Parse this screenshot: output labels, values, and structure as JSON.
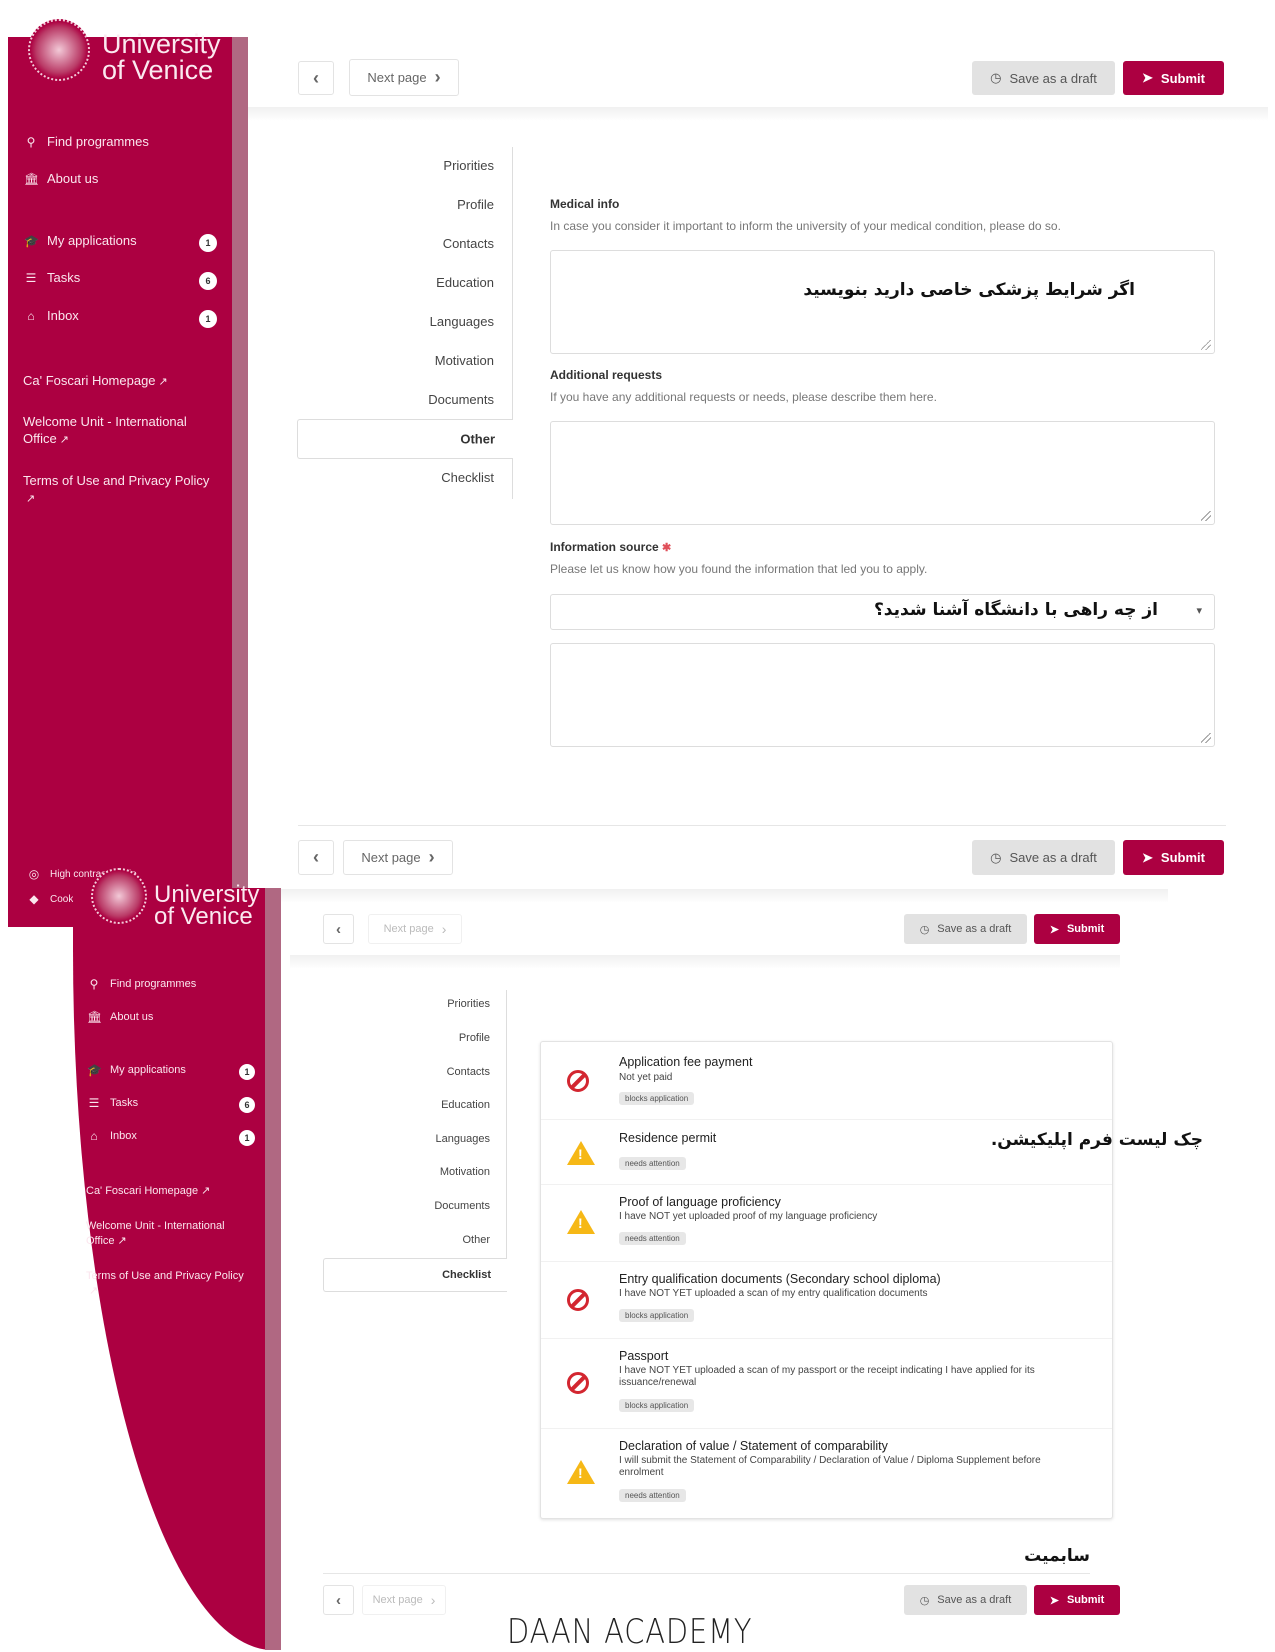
{
  "brand": {
    "line1": "University",
    "line2": "of Venice",
    "seal_text": "IN DOMO FOSCARI"
  },
  "sidebar": {
    "primary": [
      {
        "label": "Find programmes",
        "icon": "search-icon",
        "glyph": "⚲"
      },
      {
        "label": "About us",
        "icon": "institution-icon",
        "glyph": "🏛"
      }
    ],
    "personal": [
      {
        "label": "My applications",
        "icon": "graduation-cap-icon",
        "glyph": "🎓",
        "badge": "1"
      },
      {
        "label": "Tasks",
        "icon": "tasks-icon",
        "glyph": "☰",
        "badge": "6"
      },
      {
        "label": "Inbox",
        "icon": "inbox-icon",
        "glyph": "⌂",
        "badge": "1"
      }
    ],
    "links": [
      {
        "label": "Ca' Foscari Homepage",
        "icon": "external-link-icon"
      },
      {
        "label": "Welcome Unit - International Office",
        "icon": "external-link-icon"
      },
      {
        "label": "Terms of Use and Privacy Policy",
        "icon": "external-link-icon"
      }
    ],
    "footer": [
      {
        "label": "High contrast mode",
        "icon": "contrast-icon"
      },
      {
        "label": "Cook",
        "icon": "tag-icon"
      }
    ]
  },
  "toolbar": {
    "prev_glyph": "‹",
    "next_label": "Next page",
    "next_glyph": "›",
    "draft_label": "Save as a draft",
    "draft_glyph": "◷",
    "submit_label": "Submit",
    "submit_glyph": "➤"
  },
  "tabs": [
    "Priorities",
    "Profile",
    "Contacts",
    "Education",
    "Languages",
    "Motivation",
    "Documents",
    "Other",
    "Checklist"
  ],
  "form": {
    "active_tab": "Other",
    "medical": {
      "label": "Medical info",
      "help": "In case you consider it important to inform the university of your medical condition, please do so.",
      "value": "",
      "annotation": "اگر شرایط پزشکی خاصی دارید بنویسید"
    },
    "additional": {
      "label": "Additional requests",
      "help": "If you have any additional requests or needs, please describe them here.",
      "value": ""
    },
    "info_source": {
      "label": "Information source",
      "required": "✱",
      "help": "Please let us know how you found the information that led you to apply.",
      "select_value": "",
      "select_caret": "▾",
      "annotation": "از چه راهی با دانشگاه آشنا شدید؟",
      "details_value": ""
    }
  },
  "checklist": {
    "active_tab": "Checklist",
    "annotation": "چک لیست فرم اپلیکیشن.",
    "items": [
      {
        "title": "Application fee payment",
        "desc": "Not yet paid",
        "tag": "blocks application",
        "status": "blocked"
      },
      {
        "title": "Residence permit",
        "desc": "",
        "tag": "needs attention",
        "status": "warning"
      },
      {
        "title": "Proof of language proficiency",
        "desc": "I have NOT yet uploaded proof of my language proficiency",
        "tag": "needs attention",
        "status": "warning"
      },
      {
        "title": "Entry qualification documents (Secondary school diploma)",
        "desc": "I have NOT YET uploaded a scan of my entry qualification documents",
        "tag": "blocks application",
        "status": "blocked"
      },
      {
        "title": "Passport",
        "desc": "I have NOT YET uploaded a scan of my passport or the receipt indicating I have applied for its issuance/renewal",
        "tag": "blocks application",
        "status": "blocked"
      },
      {
        "title": "Declaration of value / Statement of comparability",
        "desc": "I will submit the Statement of Comparability / Declaration of Value / Diploma Supplement before enrolment",
        "tag": "needs attention",
        "status": "warning"
      }
    ],
    "submit_annotation": "سابمیت"
  },
  "watermark": "DAAN ACADEMY",
  "colors": {
    "brand": "#ac0041",
    "blocked": "#d32630",
    "warning": "#f6b816"
  }
}
